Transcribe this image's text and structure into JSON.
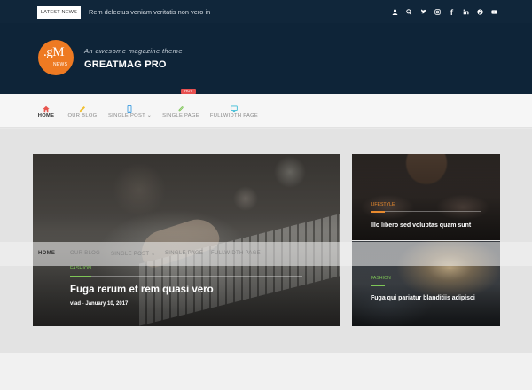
{
  "topbar": {
    "latest_label": "LATEST NEWS",
    "ticker_text": "Rem delectus veniam veritatis non vero in",
    "social_icons": [
      "user-icon",
      "search-icon",
      "twitter-icon",
      "instagram-icon",
      "facebook-icon",
      "linkedin-icon",
      "pinterest-icon",
      "youtube-icon"
    ]
  },
  "header": {
    "logo_text": ".gM",
    "logo_sub": "NEWS",
    "tagline": "An awesome magazine theme",
    "site_name": "GREATMAG PRO",
    "colors": {
      "header_bg": "#0e2438",
      "logo_bg": "#ee7a22"
    }
  },
  "nav": {
    "items": [
      {
        "label": "HOME",
        "icon": "home-icon",
        "icon_color": "#e8554e"
      },
      {
        "label": "OUR BLOG",
        "icon": "pencil-icon",
        "icon_color": "#f0c030"
      },
      {
        "label": "SINGLE POST",
        "icon": "mobile-icon",
        "icon_color": "#3a9be0"
      },
      {
        "label": "SINGLE PAGE",
        "icon": "paperclip-icon",
        "icon_color": "#7ec657"
      },
      {
        "label": "FULLWIDTH PAGE",
        "icon": "monitor-icon",
        "icon_color": "#3bbcd6"
      }
    ],
    "hot_badge": "HOT",
    "active": "HOME"
  },
  "featured": {
    "category": "FASHION",
    "title": "Fuga rerum et rem quasi vero",
    "author": "vlad",
    "separator": "-",
    "date": "January 10, 2017"
  },
  "side_posts": [
    {
      "category": "LIFESTYLE",
      "title": "Illo libero sed voluptas quam sunt",
      "category_color": "#e88a2e"
    },
    {
      "category": "FASHION",
      "title": "Fuga qui pariatur blanditiis adipisci",
      "category_color": "#7ec657"
    }
  ],
  "sticky_nav": {
    "items": [
      "HOME",
      "OUR BLOG",
      "SINGLE POST",
      "SINGLE PAGE",
      "FULLWIDTH PAGE"
    ]
  }
}
